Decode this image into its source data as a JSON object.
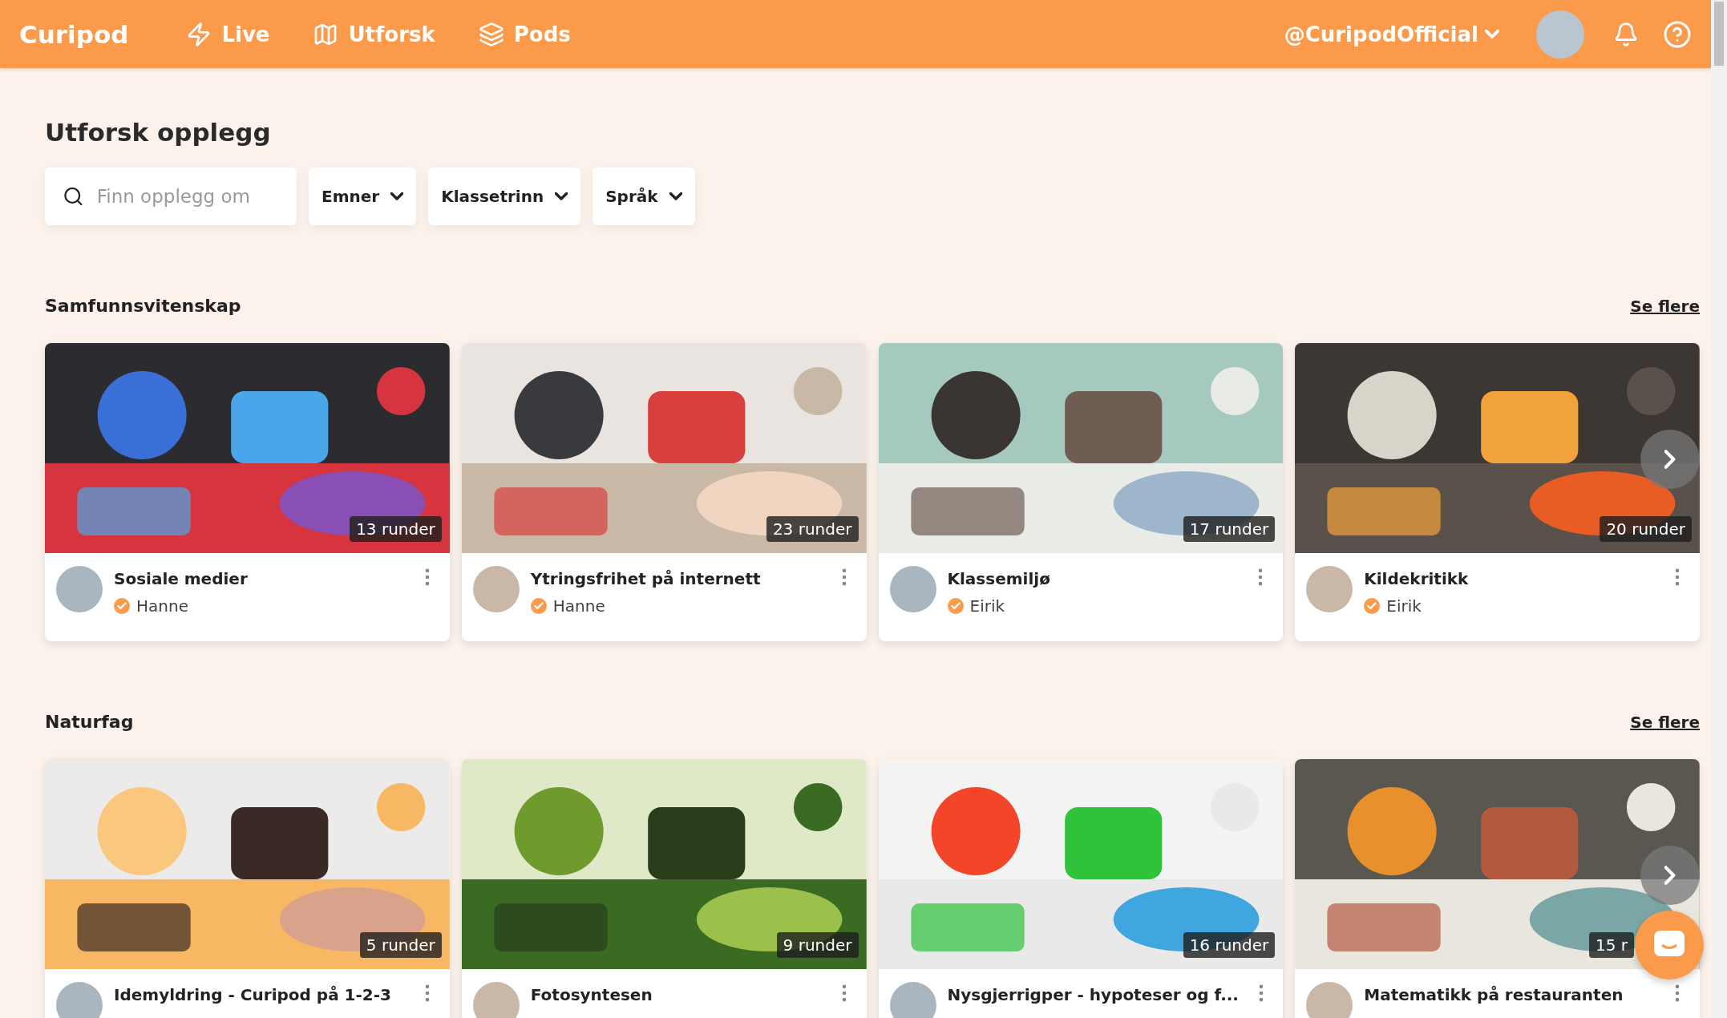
{
  "nav": {
    "logo": "Curipod",
    "links": [
      {
        "label": "Live"
      },
      {
        "label": "Utforsk"
      },
      {
        "label": "Pods"
      }
    ],
    "account": "@CuripodOfficial"
  },
  "page_title": "Utforsk opplegg",
  "search": {
    "placeholder": "Finn opplegg om"
  },
  "filters": [
    "Emner",
    "Klassetrinn",
    "Språk"
  ],
  "sections": [
    {
      "title": "Samfunnsvitenskap",
      "more": "Se flere",
      "cards": [
        {
          "rounds": "13 runder",
          "title": "Sosiale medier",
          "author": "Hanne"
        },
        {
          "rounds": "23 runder",
          "title": "Ytringsfrihet på internett",
          "author": "Hanne"
        },
        {
          "rounds": "17 runder",
          "title": "Klassemiljø",
          "author": "Eirik"
        },
        {
          "rounds": "20 runder",
          "title": "Kildekritikk",
          "author": "Eirik"
        }
      ]
    },
    {
      "title": "Naturfag",
      "more": "Se flere",
      "cards": [
        {
          "rounds": "5 runder",
          "title": "Idemyldring - Curipod på 1-2-3"
        },
        {
          "rounds": "9 runder",
          "title": "Fotosyntesen"
        },
        {
          "rounds": "16 runder",
          "title": "Nysgjerrigper - hypoteser og f..."
        },
        {
          "rounds": "15 r",
          "title": "Matematikk på restauranten"
        }
      ]
    }
  ]
}
